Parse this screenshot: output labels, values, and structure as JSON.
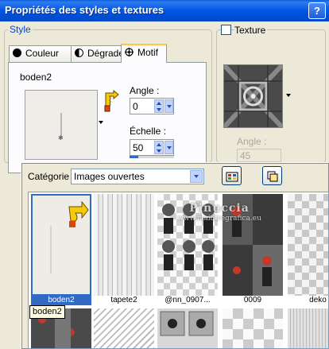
{
  "window": {
    "title": "Propriétés des styles et textures",
    "help_label": "?"
  },
  "style_group": {
    "label": "Style",
    "tabs": [
      {
        "label": "Couleur",
        "icon": "solid-circle-icon"
      },
      {
        "label": "Dégradé",
        "icon": "half-circle-icon"
      },
      {
        "label": "Motif",
        "icon": "pattern-icon",
        "active": true
      }
    ],
    "pattern_name": "boden2",
    "angle_label": "Angle :",
    "angle_value": "0",
    "scale_label": "Échelle :",
    "scale_value": "50",
    "scale_fraction": 0.2
  },
  "texture_group": {
    "checkbox_label": "Texture",
    "checked": false,
    "angle_label": "Angle :",
    "angle_value": "45"
  },
  "popup": {
    "category_label": "Catégorie :",
    "category_value": "Images ouvertes",
    "thumbnails": [
      {
        "caption": "boden2",
        "selected": true
      },
      {
        "caption": "tapete2",
        "selected": false
      },
      {
        "caption": "@nn_0907...",
        "selected": false
      },
      {
        "caption": "0009",
        "selected": false
      },
      {
        "caption": "deko",
        "selected": false
      }
    ],
    "tooltip": "boden2",
    "watermark_line1": "Pinuccia",
    "watermark_line2": "www.maidiregrafica.eu"
  },
  "colors": {
    "title_bar": "#0055e5",
    "dialog_bg": "#ece9d8",
    "group_label": "#0046d5",
    "selection": "#316ac5",
    "tab_highlight": "#ffc83c"
  }
}
